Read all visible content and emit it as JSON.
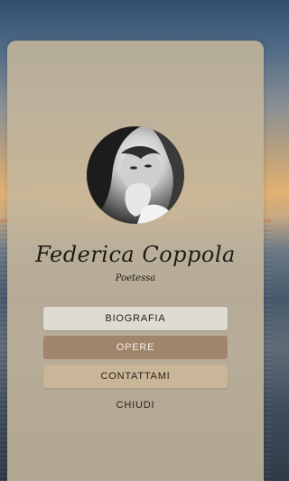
{
  "profile": {
    "name": "Federica Coppola",
    "role": "Poetessa"
  },
  "menu": {
    "biografia": "BIOGRAFIA",
    "opere": "OPERE",
    "contattami": "CONTATTAMI",
    "chiudi": "CHIUDI"
  },
  "colors": {
    "card": "#c4b69c",
    "button_light": "#dedbd2",
    "button_active": "#a1846c",
    "button_tan": "#c9b597"
  }
}
